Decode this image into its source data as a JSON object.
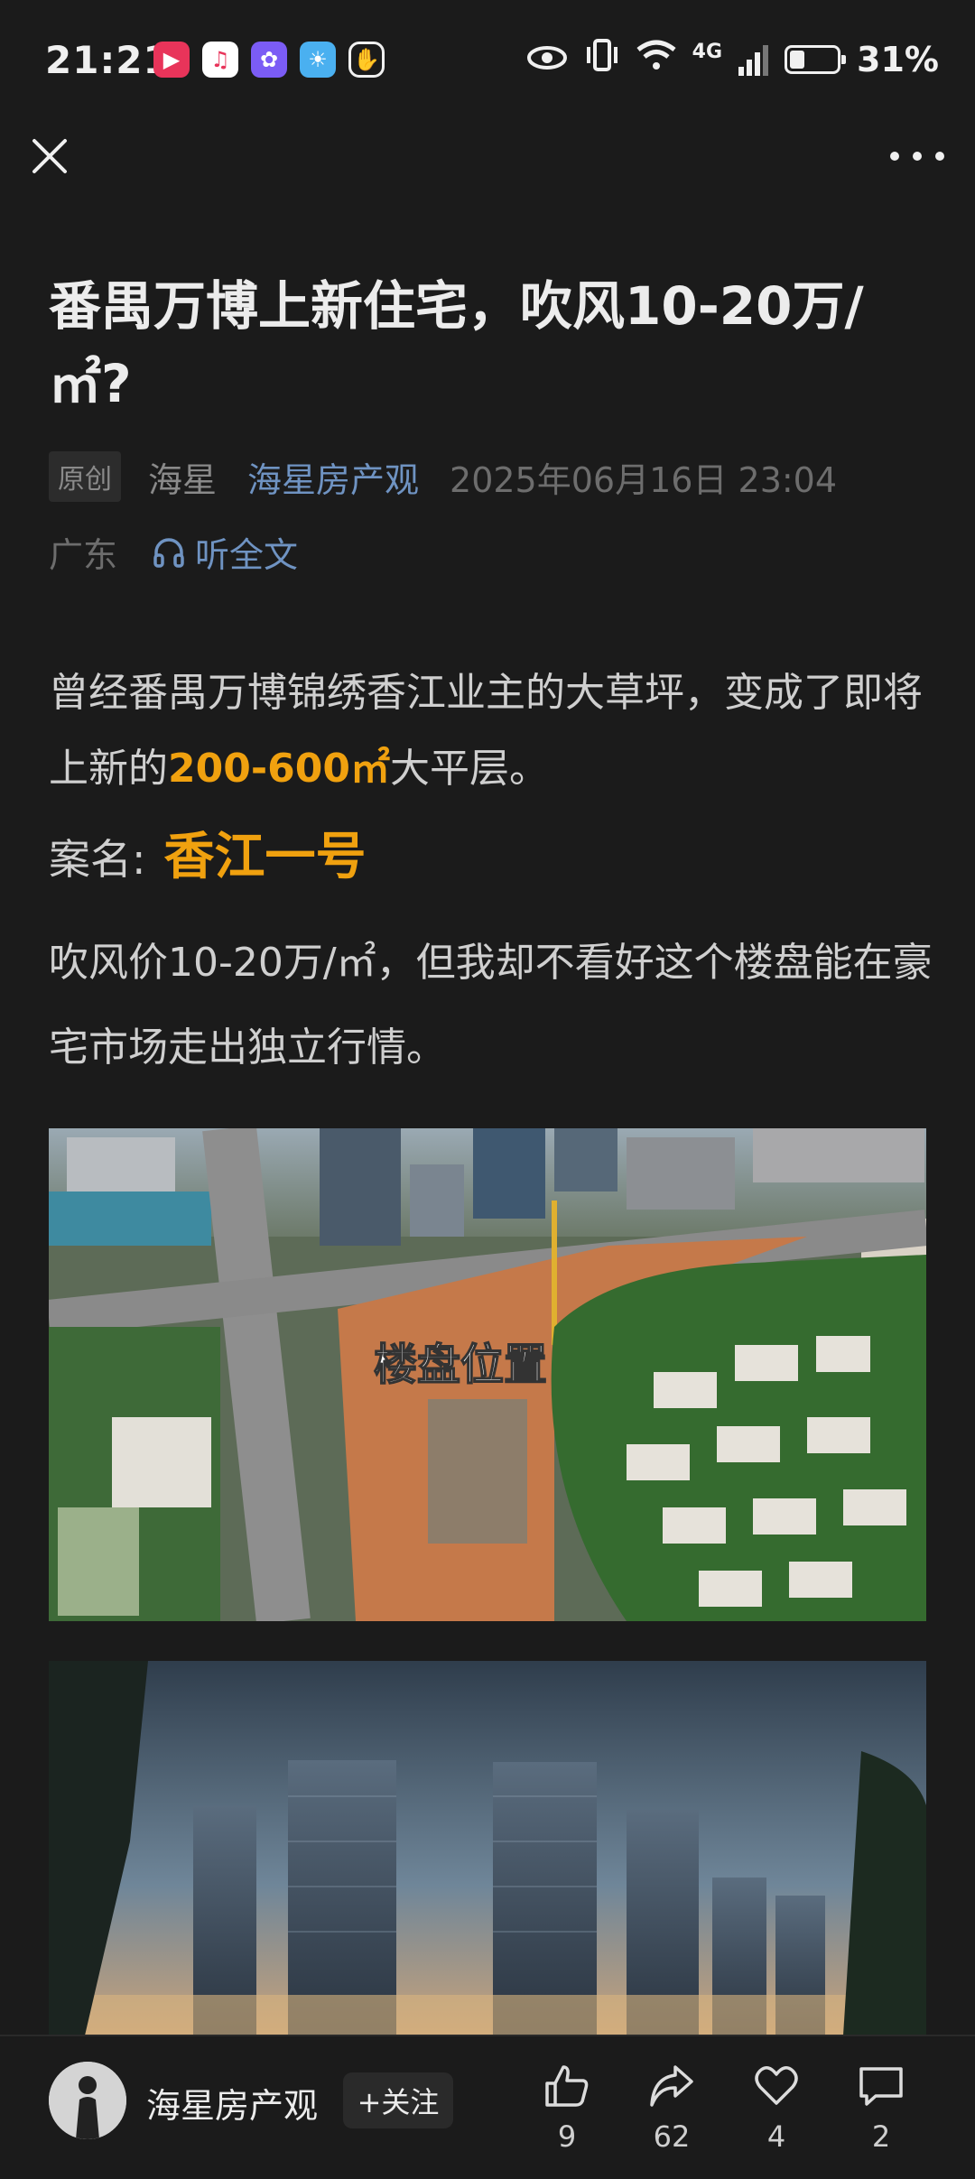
{
  "status_bar": {
    "time": "21:21",
    "network": "4G",
    "battery": "31%",
    "battery_level": 0.31
  },
  "header": {
    "close_icon": "close-icon",
    "more_icon": "more-icon"
  },
  "article": {
    "title": "番禺万博上新住宅，吹风10-20万/㎡?",
    "badge": "原创",
    "author": "海星",
    "channel": "海星房产观",
    "date": "2025年06月16日 23:04",
    "region": "广东",
    "listen_label": "听全文",
    "p1_a": "曾经番禺万博锦绣香江业主的大草坪，变成了即将上新的",
    "p1_highlight": "200-600㎡",
    "p1_b": "大平层。",
    "p2_label": "案名:",
    "p2_value": "香江一号",
    "p3": "吹风价10-20万/㎡，但我却不看好这个楼盘能在豪宅市场走出独立行情。",
    "img1_caption": "楼盘位置"
  },
  "bottom_bar": {
    "name": "海星房产观",
    "follow_label": "+关注",
    "likes": "9",
    "shares": "62",
    "favorites": "4",
    "comments": "2"
  },
  "colors": {
    "background": "#1b1b1b",
    "highlight": "#f0a10f",
    "link": "#6f93c2"
  }
}
